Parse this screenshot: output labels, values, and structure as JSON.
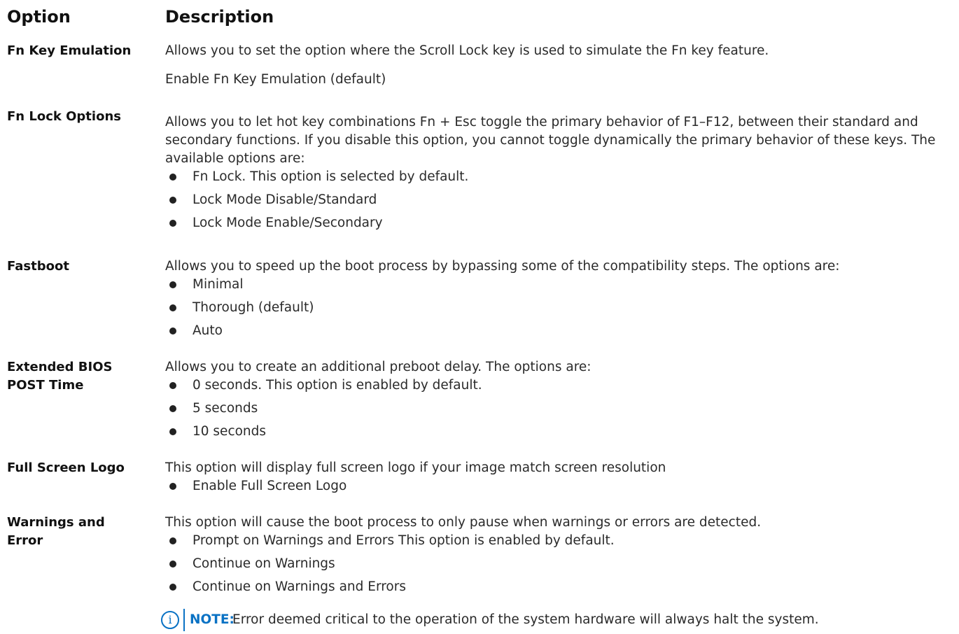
{
  "header": {
    "col1": "Option",
    "col2": "Description"
  },
  "rows": [
    {
      "option": "Fn Key Emulation",
      "description": "Allows you to set the option where the Scroll Lock key is used to simulate the Fn key feature.",
      "extra": "Enable Fn Key Emulation (default)"
    },
    {
      "option": "Fn Lock Options",
      "description": "Allows you to let hot key combinations Fn + Esc toggle the primary behavior of F1–F12, between their standard and secondary functions. If you disable this option, you cannot toggle dynamically the primary behavior of these keys. The available options are:",
      "bullets": [
        "Fn Lock. This option is selected by default.",
        "Lock Mode Disable/Standard",
        "Lock Mode Enable/Secondary"
      ]
    },
    {
      "option": "Fastboot",
      "description": "Allows you to speed up the boot process by bypassing some of the compatibility steps. The options are:",
      "bullets": [
        "Minimal",
        "Thorough (default)",
        "Auto"
      ]
    },
    {
      "option": "Extended BIOS POST Time",
      "description": "Allows you to create an additional preboot delay. The options are:",
      "bullets": [
        "0 seconds. This option is enabled by default.",
        "5 seconds",
        "10 seconds"
      ]
    },
    {
      "option": "Full Screen Logo",
      "description": "This option will display full screen logo if your image match screen resolution",
      "bullets": [
        "Enable Full Screen Logo"
      ]
    },
    {
      "option": "Warnings and Error",
      "description": "This option will cause the boot process to only pause when warnings or errors are detected.",
      "bullets": [
        "Prompt on Warnings and Errors This option is enabled by default.",
        "Continue on Warnings",
        "Continue on Warnings and Errors"
      ]
    }
  ],
  "note": {
    "label": "NOTE:",
    "text": "Error deemed critical to the operation of the system hardware will always halt the system.",
    "icon": "info-icon",
    "accent": "#0a72c4"
  }
}
